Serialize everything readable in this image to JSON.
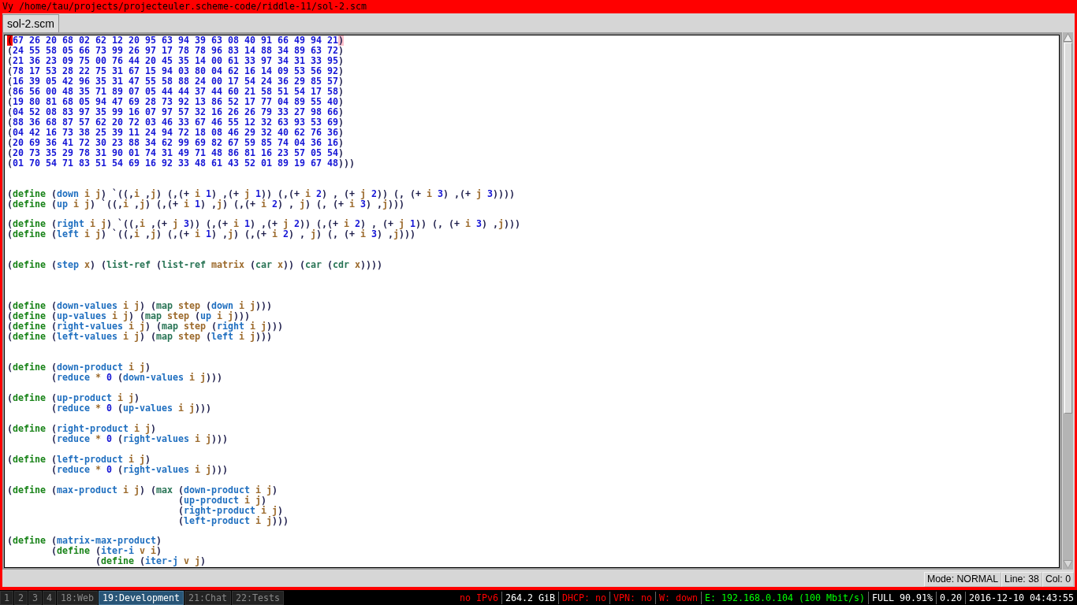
{
  "window": {
    "title": "Vy /home/tau/projects/projecteuler.scheme-code/riddle-11/sol-2.scm"
  },
  "tabs": [
    {
      "label": "sol-2.scm",
      "selected": true
    }
  ],
  "editor": {
    "lines": [
      {
        "kind": "code",
        "segments": [
          {
            "kind": "cursor",
            "text": "("
          },
          {
            "kind": "number",
            "text": "67 26 20 68 02 62 12 20 95 63 94 39 63 08 40 91 66 49 94 21"
          },
          {
            "kind": "match",
            "text": ")"
          }
        ]
      },
      {
        "kind": "code",
        "segments": [
          {
            "kind": "paren",
            "text": "("
          },
          {
            "kind": "number",
            "text": "24 55 58 05 66 73 99 26 97 17 78 78 96 83 14 88 34 89 63 72"
          },
          {
            "kind": "paren",
            "text": ")"
          }
        ]
      },
      {
        "kind": "code",
        "segments": [
          {
            "kind": "paren",
            "text": "("
          },
          {
            "kind": "number",
            "text": "21 36 23 09 75 00 76 44 20 45 35 14 00 61 33 97 34 31 33 95"
          },
          {
            "kind": "paren",
            "text": ")"
          }
        ]
      },
      {
        "kind": "code",
        "segments": [
          {
            "kind": "paren",
            "text": "("
          },
          {
            "kind": "number",
            "text": "78 17 53 28 22 75 31 67 15 94 03 80 04 62 16 14 09 53 56 92"
          },
          {
            "kind": "paren",
            "text": ")"
          }
        ]
      },
      {
        "kind": "code",
        "segments": [
          {
            "kind": "paren",
            "text": "("
          },
          {
            "kind": "number",
            "text": "16 39 05 42 96 35 31 47 55 58 88 24 00 17 54 24 36 29 85 57"
          },
          {
            "kind": "paren",
            "text": ")"
          }
        ]
      },
      {
        "kind": "code",
        "segments": [
          {
            "kind": "paren",
            "text": "("
          },
          {
            "kind": "number",
            "text": "86 56 00 48 35 71 89 07 05 44 44 37 44 60 21 58 51 54 17 58"
          },
          {
            "kind": "paren",
            "text": ")"
          }
        ]
      },
      {
        "kind": "code",
        "segments": [
          {
            "kind": "paren",
            "text": "("
          },
          {
            "kind": "number",
            "text": "19 80 81 68 05 94 47 69 28 73 92 13 86 52 17 77 04 89 55 40"
          },
          {
            "kind": "paren",
            "text": ")"
          }
        ]
      },
      {
        "kind": "code",
        "segments": [
          {
            "kind": "paren",
            "text": "("
          },
          {
            "kind": "number",
            "text": "04 52 08 83 97 35 99 16 07 97 57 32 16 26 26 79 33 27 98 66"
          },
          {
            "kind": "paren",
            "text": ")"
          }
        ]
      },
      {
        "kind": "code",
        "segments": [
          {
            "kind": "paren",
            "text": "("
          },
          {
            "kind": "number",
            "text": "88 36 68 87 57 62 20 72 03 46 33 67 46 55 12 32 63 93 53 69"
          },
          {
            "kind": "paren",
            "text": ")"
          }
        ]
      },
      {
        "kind": "code",
        "segments": [
          {
            "kind": "paren",
            "text": "("
          },
          {
            "kind": "number",
            "text": "04 42 16 73 38 25 39 11 24 94 72 18 08 46 29 32 40 62 76 36"
          },
          {
            "kind": "paren",
            "text": ")"
          }
        ]
      },
      {
        "kind": "code",
        "segments": [
          {
            "kind": "paren",
            "text": "("
          },
          {
            "kind": "number",
            "text": "20 69 36 41 72 30 23 88 34 62 99 69 82 67 59 85 74 04 36 16"
          },
          {
            "kind": "paren",
            "text": ")"
          }
        ]
      },
      {
        "kind": "code",
        "segments": [
          {
            "kind": "paren",
            "text": "("
          },
          {
            "kind": "number",
            "text": "20 73 35 29 78 31 90 01 74 31 49 71 48 86 81 16 23 57 05 54"
          },
          {
            "kind": "paren",
            "text": ")"
          }
        ]
      },
      {
        "kind": "code",
        "segments": [
          {
            "kind": "paren",
            "text": "("
          },
          {
            "kind": "number",
            "text": "01 70 54 71 83 51 54 69 16 92 33 48 61 43 52 01 89 19 67 48"
          },
          {
            "kind": "paren",
            "text": ")))"
          }
        ]
      },
      {
        "kind": "blank"
      },
      {
        "kind": "blank"
      },
      {
        "kind": "code",
        "segments": [
          {
            "kind": "paren",
            "text": "("
          },
          {
            "kind": "keyword",
            "text": "define"
          },
          {
            "kind": "paren",
            "text": " ("
          },
          {
            "kind": "function",
            "text": "down"
          },
          {
            "kind": "symbol",
            "text": " i j"
          },
          {
            "kind": "paren",
            "text": ") `((,"
          },
          {
            "kind": "symbol",
            "text": "i"
          },
          {
            "kind": "paren",
            "text": " ,"
          },
          {
            "kind": "symbol",
            "text": "j"
          },
          {
            "kind": "paren",
            "text": ") (,(+ "
          },
          {
            "kind": "symbol",
            "text": "i "
          },
          {
            "kind": "number",
            "text": "1"
          },
          {
            "kind": "paren",
            "text": ") ,(+ "
          },
          {
            "kind": "symbol",
            "text": "j "
          },
          {
            "kind": "number",
            "text": "1"
          },
          {
            "kind": "paren",
            "text": ")) (,(+ "
          },
          {
            "kind": "symbol",
            "text": "i "
          },
          {
            "kind": "number",
            "text": "2"
          },
          {
            "kind": "paren",
            "text": ") , (+ "
          },
          {
            "kind": "symbol",
            "text": "j "
          },
          {
            "kind": "number",
            "text": "2"
          },
          {
            "kind": "paren",
            "text": ")) (, (+ "
          },
          {
            "kind": "symbol",
            "text": "i "
          },
          {
            "kind": "number",
            "text": "3"
          },
          {
            "kind": "paren",
            "text": ") ,(+ "
          },
          {
            "kind": "symbol",
            "text": "j "
          },
          {
            "kind": "number",
            "text": "3"
          },
          {
            "kind": "paren",
            "text": "))))"
          }
        ]
      },
      {
        "kind": "code",
        "segments": [
          {
            "kind": "paren",
            "text": "("
          },
          {
            "kind": "keyword",
            "text": "define"
          },
          {
            "kind": "paren",
            "text": " ("
          },
          {
            "kind": "function",
            "text": "up"
          },
          {
            "kind": "symbol",
            "text": " i j"
          },
          {
            "kind": "paren",
            "text": ") `((,"
          },
          {
            "kind": "symbol",
            "text": "i"
          },
          {
            "kind": "paren",
            "text": " ,"
          },
          {
            "kind": "symbol",
            "text": "j"
          },
          {
            "kind": "paren",
            "text": ") (,(+ "
          },
          {
            "kind": "symbol",
            "text": "i "
          },
          {
            "kind": "number",
            "text": "1"
          },
          {
            "kind": "paren",
            "text": ") ,"
          },
          {
            "kind": "symbol",
            "text": "j"
          },
          {
            "kind": "paren",
            "text": ") (,(+ "
          },
          {
            "kind": "symbol",
            "text": "i "
          },
          {
            "kind": "number",
            "text": "2"
          },
          {
            "kind": "paren",
            "text": ") , "
          },
          {
            "kind": "symbol",
            "text": "j"
          },
          {
            "kind": "paren",
            "text": ") (, (+ "
          },
          {
            "kind": "symbol",
            "text": "i "
          },
          {
            "kind": "number",
            "text": "3"
          },
          {
            "kind": "paren",
            "text": ") ,"
          },
          {
            "kind": "symbol",
            "text": "j"
          },
          {
            "kind": "paren",
            "text": ")))"
          }
        ]
      },
      {
        "kind": "blank"
      },
      {
        "kind": "code",
        "segments": [
          {
            "kind": "paren",
            "text": "("
          },
          {
            "kind": "keyword",
            "text": "define"
          },
          {
            "kind": "paren",
            "text": " ("
          },
          {
            "kind": "function",
            "text": "right"
          },
          {
            "kind": "symbol",
            "text": " i j"
          },
          {
            "kind": "paren",
            "text": ") `((,"
          },
          {
            "kind": "symbol",
            "text": "i"
          },
          {
            "kind": "paren",
            "text": " ,(+ "
          },
          {
            "kind": "symbol",
            "text": "j "
          },
          {
            "kind": "number",
            "text": "3"
          },
          {
            "kind": "paren",
            "text": ")) (,(+ "
          },
          {
            "kind": "symbol",
            "text": "i "
          },
          {
            "kind": "number",
            "text": "1"
          },
          {
            "kind": "paren",
            "text": ") ,(+ "
          },
          {
            "kind": "symbol",
            "text": "j "
          },
          {
            "kind": "number",
            "text": "2"
          },
          {
            "kind": "paren",
            "text": ")) (,(+ "
          },
          {
            "kind": "symbol",
            "text": "i "
          },
          {
            "kind": "number",
            "text": "2"
          },
          {
            "kind": "paren",
            "text": ") , (+ "
          },
          {
            "kind": "symbol",
            "text": "j "
          },
          {
            "kind": "number",
            "text": "1"
          },
          {
            "kind": "paren",
            "text": ")) (, (+ "
          },
          {
            "kind": "symbol",
            "text": "i "
          },
          {
            "kind": "number",
            "text": "3"
          },
          {
            "kind": "paren",
            "text": ") ,"
          },
          {
            "kind": "symbol",
            "text": "j"
          },
          {
            "kind": "paren",
            "text": ")))"
          }
        ]
      },
      {
        "kind": "code",
        "segments": [
          {
            "kind": "paren",
            "text": "("
          },
          {
            "kind": "keyword",
            "text": "define"
          },
          {
            "kind": "paren",
            "text": " ("
          },
          {
            "kind": "function",
            "text": "left"
          },
          {
            "kind": "symbol",
            "text": " i j"
          },
          {
            "kind": "paren",
            "text": ") `((,"
          },
          {
            "kind": "symbol",
            "text": "i"
          },
          {
            "kind": "paren",
            "text": " ,"
          },
          {
            "kind": "symbol",
            "text": "j"
          },
          {
            "kind": "paren",
            "text": ") (,(+ "
          },
          {
            "kind": "symbol",
            "text": "i "
          },
          {
            "kind": "number",
            "text": "1"
          },
          {
            "kind": "paren",
            "text": ") ,"
          },
          {
            "kind": "symbol",
            "text": "j"
          },
          {
            "kind": "paren",
            "text": ") (,(+ "
          },
          {
            "kind": "symbol",
            "text": "i "
          },
          {
            "kind": "number",
            "text": "2"
          },
          {
            "kind": "paren",
            "text": ") , "
          },
          {
            "kind": "symbol",
            "text": "j"
          },
          {
            "kind": "paren",
            "text": ") (, (+ "
          },
          {
            "kind": "symbol",
            "text": "i "
          },
          {
            "kind": "number",
            "text": "3"
          },
          {
            "kind": "paren",
            "text": ") ,"
          },
          {
            "kind": "symbol",
            "text": "j"
          },
          {
            "kind": "paren",
            "text": ")))"
          }
        ]
      },
      {
        "kind": "blank"
      },
      {
        "kind": "blank"
      },
      {
        "kind": "code",
        "segments": [
          {
            "kind": "paren",
            "text": "("
          },
          {
            "kind": "keyword",
            "text": "define"
          },
          {
            "kind": "paren",
            "text": " ("
          },
          {
            "kind": "function",
            "text": "step"
          },
          {
            "kind": "symbol",
            "text": " x"
          },
          {
            "kind": "paren",
            "text": ") ("
          },
          {
            "kind": "builtin",
            "text": "list-ref"
          },
          {
            "kind": "paren",
            "text": " ("
          },
          {
            "kind": "builtin",
            "text": "list-ref"
          },
          {
            "kind": "symbol",
            "text": " matrix"
          },
          {
            "kind": "paren",
            "text": " ("
          },
          {
            "kind": "builtin",
            "text": "car"
          },
          {
            "kind": "symbol",
            "text": " x"
          },
          {
            "kind": "paren",
            "text": ")) ("
          },
          {
            "kind": "builtin",
            "text": "car"
          },
          {
            "kind": "paren",
            "text": " ("
          },
          {
            "kind": "builtin",
            "text": "cdr"
          },
          {
            "kind": "symbol",
            "text": " x"
          },
          {
            "kind": "paren",
            "text": "))))"
          }
        ]
      },
      {
        "kind": "blank"
      },
      {
        "kind": "blank"
      },
      {
        "kind": "blank"
      },
      {
        "kind": "code",
        "segments": [
          {
            "kind": "paren",
            "text": "("
          },
          {
            "kind": "keyword",
            "text": "define"
          },
          {
            "kind": "paren",
            "text": " ("
          },
          {
            "kind": "function",
            "text": "down-values"
          },
          {
            "kind": "symbol",
            "text": " i j"
          },
          {
            "kind": "paren",
            "text": ") ("
          },
          {
            "kind": "builtin",
            "text": "map"
          },
          {
            "kind": "symbol",
            "text": " step"
          },
          {
            "kind": "paren",
            "text": " ("
          },
          {
            "kind": "function",
            "text": "down"
          },
          {
            "kind": "symbol",
            "text": " i j"
          },
          {
            "kind": "paren",
            "text": ")))"
          }
        ]
      },
      {
        "kind": "code",
        "segments": [
          {
            "kind": "paren",
            "text": "("
          },
          {
            "kind": "keyword",
            "text": "define"
          },
          {
            "kind": "paren",
            "text": " ("
          },
          {
            "kind": "function",
            "text": "up-values"
          },
          {
            "kind": "symbol",
            "text": " i j"
          },
          {
            "kind": "paren",
            "text": ") ("
          },
          {
            "kind": "builtin",
            "text": "map"
          },
          {
            "kind": "symbol",
            "text": " step"
          },
          {
            "kind": "paren",
            "text": " ("
          },
          {
            "kind": "function",
            "text": "up"
          },
          {
            "kind": "symbol",
            "text": " i j"
          },
          {
            "kind": "paren",
            "text": ")))"
          }
        ]
      },
      {
        "kind": "code",
        "segments": [
          {
            "kind": "paren",
            "text": "("
          },
          {
            "kind": "keyword",
            "text": "define"
          },
          {
            "kind": "paren",
            "text": " ("
          },
          {
            "kind": "function",
            "text": "right-values"
          },
          {
            "kind": "symbol",
            "text": " i j"
          },
          {
            "kind": "paren",
            "text": ") ("
          },
          {
            "kind": "builtin",
            "text": "map"
          },
          {
            "kind": "symbol",
            "text": " step"
          },
          {
            "kind": "paren",
            "text": " ("
          },
          {
            "kind": "function",
            "text": "right"
          },
          {
            "kind": "symbol",
            "text": " i j"
          },
          {
            "kind": "paren",
            "text": ")))"
          }
        ]
      },
      {
        "kind": "code",
        "segments": [
          {
            "kind": "paren",
            "text": "("
          },
          {
            "kind": "keyword",
            "text": "define"
          },
          {
            "kind": "paren",
            "text": " ("
          },
          {
            "kind": "function",
            "text": "left-values"
          },
          {
            "kind": "symbol",
            "text": " i j"
          },
          {
            "kind": "paren",
            "text": ") ("
          },
          {
            "kind": "builtin",
            "text": "map"
          },
          {
            "kind": "symbol",
            "text": " step"
          },
          {
            "kind": "paren",
            "text": " ("
          },
          {
            "kind": "function",
            "text": "left"
          },
          {
            "kind": "symbol",
            "text": " i j"
          },
          {
            "kind": "paren",
            "text": ")))"
          }
        ]
      },
      {
        "kind": "blank"
      },
      {
        "kind": "blank"
      },
      {
        "kind": "code",
        "segments": [
          {
            "kind": "paren",
            "text": "("
          },
          {
            "kind": "keyword",
            "text": "define"
          },
          {
            "kind": "paren",
            "text": " ("
          },
          {
            "kind": "function",
            "text": "down-product"
          },
          {
            "kind": "symbol",
            "text": " i j"
          },
          {
            "kind": "paren",
            "text": ")"
          }
        ]
      },
      {
        "kind": "code",
        "segments": [
          {
            "kind": "paren",
            "text": "        ("
          },
          {
            "kind": "function",
            "text": "reduce"
          },
          {
            "kind": "symbol",
            "text": " * "
          },
          {
            "kind": "number",
            "text": "0"
          },
          {
            "kind": "paren",
            "text": " ("
          },
          {
            "kind": "function",
            "text": "down-values"
          },
          {
            "kind": "symbol",
            "text": " i j"
          },
          {
            "kind": "paren",
            "text": ")))"
          }
        ]
      },
      {
        "kind": "blank"
      },
      {
        "kind": "code",
        "segments": [
          {
            "kind": "paren",
            "text": "("
          },
          {
            "kind": "keyword",
            "text": "define"
          },
          {
            "kind": "paren",
            "text": " ("
          },
          {
            "kind": "function",
            "text": "up-product"
          },
          {
            "kind": "symbol",
            "text": " i j"
          },
          {
            "kind": "paren",
            "text": ")"
          }
        ]
      },
      {
        "kind": "code",
        "segments": [
          {
            "kind": "paren",
            "text": "        ("
          },
          {
            "kind": "function",
            "text": "reduce"
          },
          {
            "kind": "symbol",
            "text": " * "
          },
          {
            "kind": "number",
            "text": "0"
          },
          {
            "kind": "paren",
            "text": " ("
          },
          {
            "kind": "function",
            "text": "up-values"
          },
          {
            "kind": "symbol",
            "text": " i j"
          },
          {
            "kind": "paren",
            "text": ")))"
          }
        ]
      },
      {
        "kind": "blank"
      },
      {
        "kind": "code",
        "segments": [
          {
            "kind": "paren",
            "text": "("
          },
          {
            "kind": "keyword",
            "text": "define"
          },
          {
            "kind": "paren",
            "text": " ("
          },
          {
            "kind": "function",
            "text": "right-product"
          },
          {
            "kind": "symbol",
            "text": " i j"
          },
          {
            "kind": "paren",
            "text": ")"
          }
        ]
      },
      {
        "kind": "code",
        "segments": [
          {
            "kind": "paren",
            "text": "        ("
          },
          {
            "kind": "function",
            "text": "reduce"
          },
          {
            "kind": "symbol",
            "text": " * "
          },
          {
            "kind": "number",
            "text": "0"
          },
          {
            "kind": "paren",
            "text": " ("
          },
          {
            "kind": "function",
            "text": "right-values"
          },
          {
            "kind": "symbol",
            "text": " i j"
          },
          {
            "kind": "paren",
            "text": ")))"
          }
        ]
      },
      {
        "kind": "blank"
      },
      {
        "kind": "code",
        "segments": [
          {
            "kind": "paren",
            "text": "("
          },
          {
            "kind": "keyword",
            "text": "define"
          },
          {
            "kind": "paren",
            "text": " ("
          },
          {
            "kind": "function",
            "text": "left-product"
          },
          {
            "kind": "symbol",
            "text": " i j"
          },
          {
            "kind": "paren",
            "text": ")"
          }
        ]
      },
      {
        "kind": "code",
        "segments": [
          {
            "kind": "paren",
            "text": "        ("
          },
          {
            "kind": "function",
            "text": "reduce"
          },
          {
            "kind": "symbol",
            "text": " * "
          },
          {
            "kind": "number",
            "text": "0"
          },
          {
            "kind": "paren",
            "text": " ("
          },
          {
            "kind": "function",
            "text": "right-values"
          },
          {
            "kind": "symbol",
            "text": " i j"
          },
          {
            "kind": "paren",
            "text": ")))"
          }
        ]
      },
      {
        "kind": "blank"
      },
      {
        "kind": "code",
        "segments": [
          {
            "kind": "paren",
            "text": "("
          },
          {
            "kind": "keyword",
            "text": "define"
          },
          {
            "kind": "paren",
            "text": " ("
          },
          {
            "kind": "function",
            "text": "max-product"
          },
          {
            "kind": "symbol",
            "text": " i j"
          },
          {
            "kind": "paren",
            "text": ") ("
          },
          {
            "kind": "builtin",
            "text": "max"
          },
          {
            "kind": "paren",
            "text": " ("
          },
          {
            "kind": "function",
            "text": "down-product"
          },
          {
            "kind": "symbol",
            "text": " i j"
          },
          {
            "kind": "paren",
            "text": ")"
          }
        ]
      },
      {
        "kind": "code",
        "segments": [
          {
            "kind": "paren",
            "text": "                               ("
          },
          {
            "kind": "function",
            "text": "up-product"
          },
          {
            "kind": "symbol",
            "text": " i j"
          },
          {
            "kind": "paren",
            "text": ")"
          }
        ]
      },
      {
        "kind": "code",
        "segments": [
          {
            "kind": "paren",
            "text": "                               ("
          },
          {
            "kind": "function",
            "text": "right-product"
          },
          {
            "kind": "symbol",
            "text": " i j"
          },
          {
            "kind": "paren",
            "text": ")"
          }
        ]
      },
      {
        "kind": "code",
        "segments": [
          {
            "kind": "paren",
            "text": "                               ("
          },
          {
            "kind": "function",
            "text": "left-product"
          },
          {
            "kind": "symbol",
            "text": " i j"
          },
          {
            "kind": "paren",
            "text": ")))"
          }
        ]
      },
      {
        "kind": "blank"
      },
      {
        "kind": "code",
        "segments": [
          {
            "kind": "paren",
            "text": "("
          },
          {
            "kind": "keyword",
            "text": "define"
          },
          {
            "kind": "paren",
            "text": " ("
          },
          {
            "kind": "function",
            "text": "matrix-max-product"
          },
          {
            "kind": "paren",
            "text": ")"
          }
        ]
      },
      {
        "kind": "code",
        "segments": [
          {
            "kind": "paren",
            "text": "        ("
          },
          {
            "kind": "keyword",
            "text": "define"
          },
          {
            "kind": "paren",
            "text": " ("
          },
          {
            "kind": "function",
            "text": "iter-i"
          },
          {
            "kind": "symbol",
            "text": " v i"
          },
          {
            "kind": "paren",
            "text": ")"
          }
        ]
      },
      {
        "kind": "code",
        "segments": [
          {
            "kind": "paren",
            "text": "                ("
          },
          {
            "kind": "keyword",
            "text": "define"
          },
          {
            "kind": "paren",
            "text": " ("
          },
          {
            "kind": "function",
            "text": "iter-j"
          },
          {
            "kind": "symbol",
            "text": " v j"
          },
          {
            "kind": "paren",
            "text": ")"
          }
        ]
      }
    ]
  },
  "status_line": {
    "fields": [
      "Mode: NORMAL",
      "Line: 38",
      "Col: 0"
    ]
  },
  "bar": {
    "workspaces": [
      {
        "label": "1",
        "selected": false
      },
      {
        "label": "2",
        "selected": false
      },
      {
        "label": "3",
        "selected": false
      },
      {
        "label": "4",
        "selected": false
      },
      {
        "label": "18:Web",
        "selected": false
      },
      {
        "label": "19:Development",
        "selected": true
      },
      {
        "label": "21:Chat",
        "selected": false
      },
      {
        "label": "22:Tests",
        "selected": false
      }
    ],
    "status": [
      {
        "text": "no IPv6",
        "color": "#ff0000"
      },
      {
        "text": "264.2 GiB",
        "color": "#ffffff"
      },
      {
        "text": "DHCP: no",
        "color": "#ff0000"
      },
      {
        "text": "VPN: no",
        "color": "#ff0000"
      },
      {
        "text": "W: down",
        "color": "#ff0000"
      },
      {
        "text": "E: 192.168.0.104 (100 Mbit/s)",
        "color": "#00ff00"
      },
      {
        "text": "FULL 90.91%",
        "color": "#ffffff"
      },
      {
        "text": "0.20",
        "color": "#ffffff"
      },
      {
        "text": "2016-12-10 04:43:55",
        "color": "#ffffff"
      }
    ]
  }
}
